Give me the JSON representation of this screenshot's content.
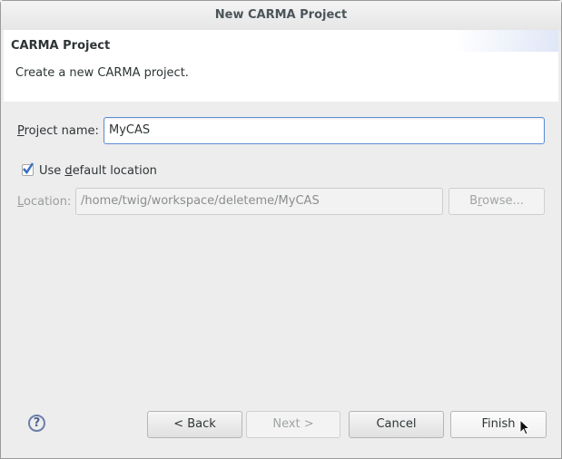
{
  "window": {
    "title": "New CARMA Project"
  },
  "header": {
    "title": "CARMA Project",
    "description": "Create a new CARMA project."
  },
  "form": {
    "project_name_label": {
      "mn": "P",
      "rest": "roject name:"
    },
    "project_name_value": "MyCAS",
    "use_default": {
      "pre": "Use ",
      "mn": "d",
      "rest": "efault location",
      "checked": true
    },
    "location_label": {
      "mn": "L",
      "rest": "ocation:"
    },
    "location_value": "/home/twig/workspace/deleteme/MyCAS",
    "browse": {
      "pre": "B",
      "mn": "r",
      "rest": "owse..."
    }
  },
  "buttons": {
    "back": "< Back",
    "next": "Next >",
    "cancel": "Cancel",
    "finish": "Finish"
  },
  "help": {
    "glyph": "?"
  }
}
